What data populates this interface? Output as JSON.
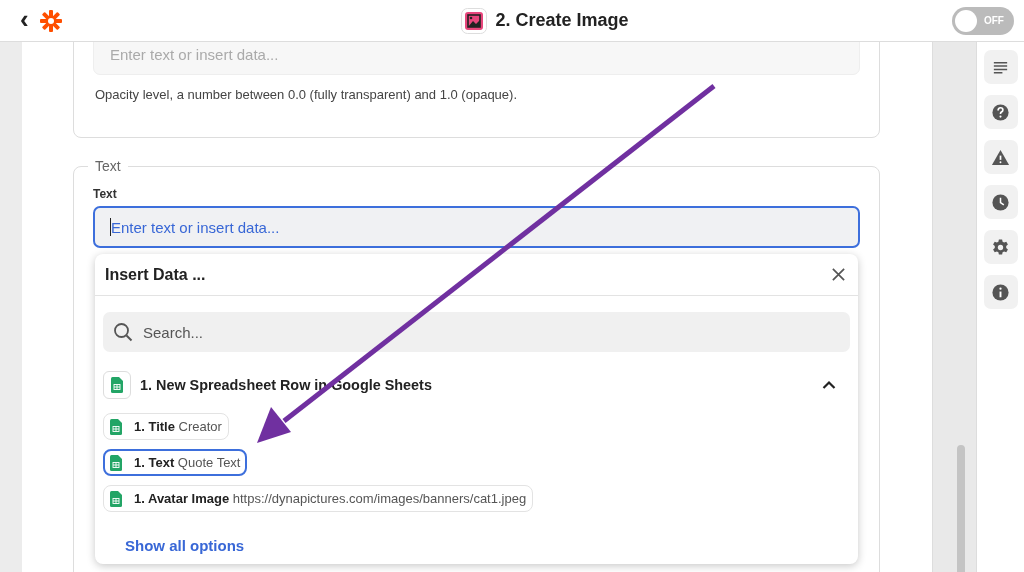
{
  "header": {
    "back": "‹",
    "title": "2. Create Image",
    "toggle": {
      "label": "OFF",
      "on": false
    }
  },
  "opacity_field": {
    "placeholder": "Enter text or insert data...",
    "help": "Opacity level, a number between 0.0 (fully transparent) and 1.0 (opaque)."
  },
  "text_section": {
    "legend": "Text",
    "label": "Text",
    "placeholder": "Enter text or insert data...",
    "focused": true
  },
  "insert_data": {
    "title": "Insert Data ...",
    "search_placeholder": "Search...",
    "group": {
      "title": "1. New Spreadsheet Row in Google Sheets",
      "expanded": true
    },
    "options": [
      {
        "key": "1. Title",
        "value": "Creator",
        "selected": false
      },
      {
        "key": "1. Text",
        "value": "Quote Text",
        "selected": true
      },
      {
        "key": "1. Avatar Image",
        "value": "https://dynapictures.com/images/banners/cat1.jpeg",
        "selected": false
      }
    ],
    "show_all": "Show all options"
  }
}
